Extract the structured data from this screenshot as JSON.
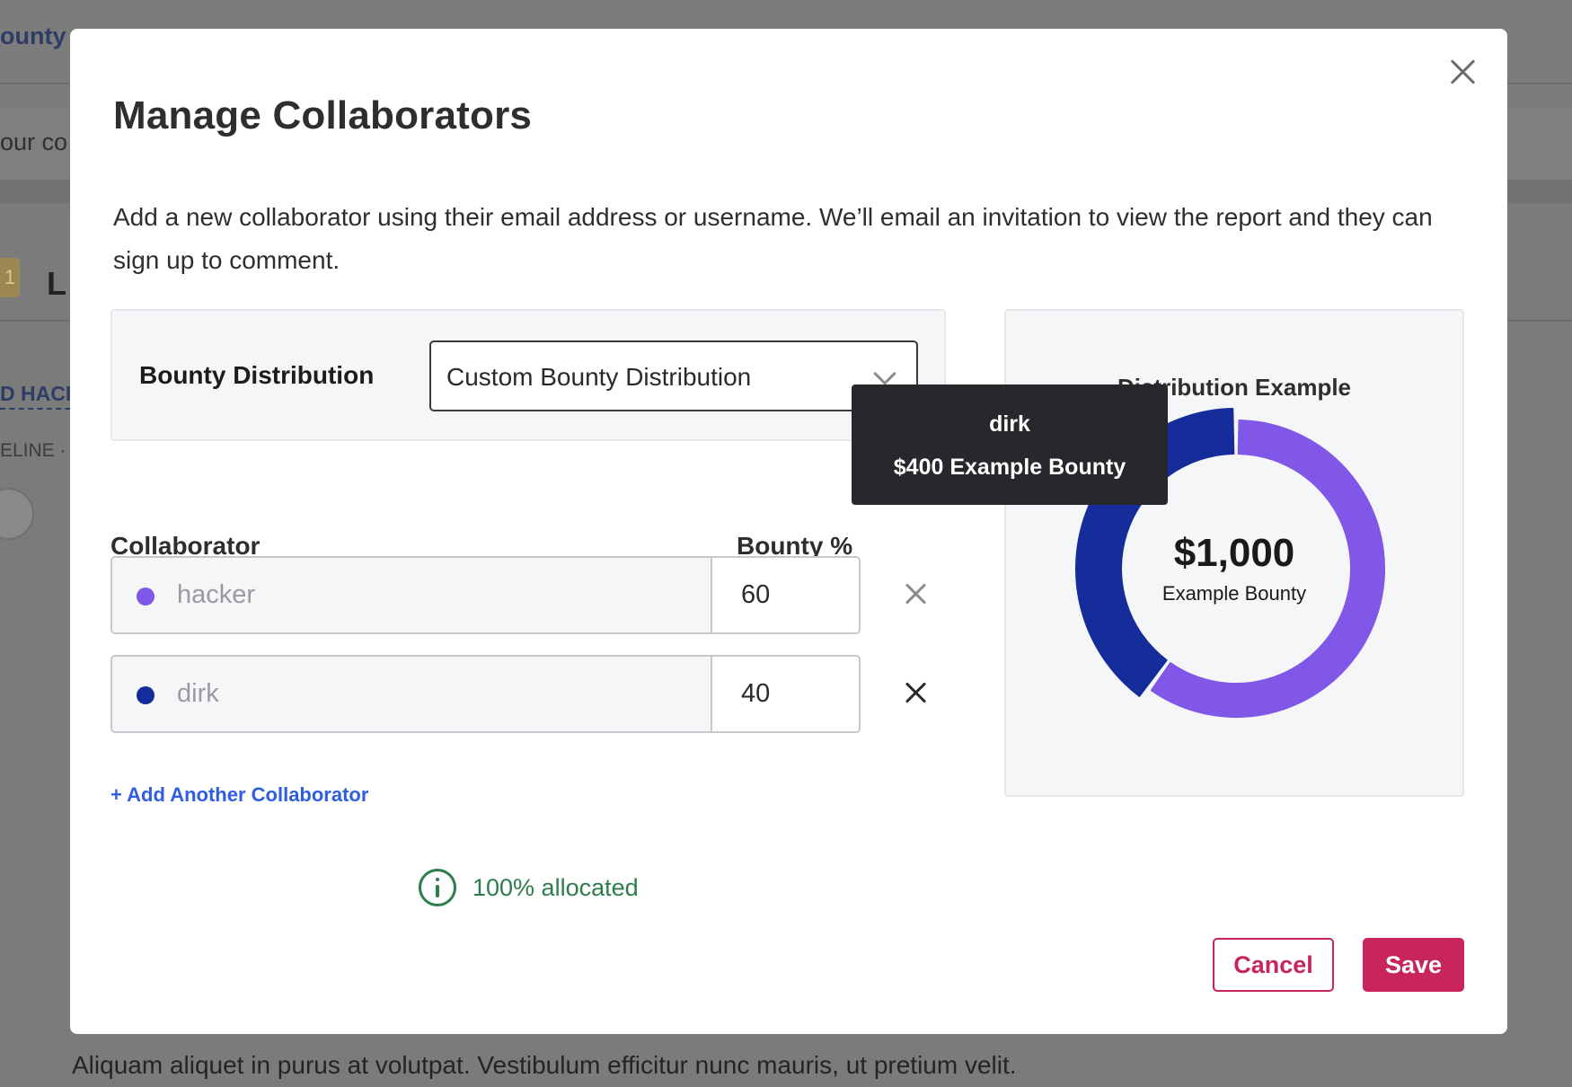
{
  "background": {
    "crumb": "ounty",
    "compose": "our co",
    "badge": "1",
    "title": "L",
    "hack_link": "HACK",
    "hack_prefix": "D",
    "eline": "ELINE ·",
    "lorem": "Aliquam aliquet in purus at volutpat. Vestibulum efficitur nunc mauris, ut pretium velit."
  },
  "modal": {
    "title": "Manage Collaborators",
    "description": "Add a new collaborator using their email address or username. We’ll email an invitation to view the report and they can sign up to comment.",
    "distribution": {
      "label": "Bounty Distribution",
      "selected": "Custom Bounty Distribution"
    },
    "columns": {
      "collaborator": "Collaborator",
      "bounty_pct": "Bounty %"
    },
    "collaborators": [
      {
        "name": "hacker",
        "percent": "60",
        "color": "#8057e6"
      },
      {
        "name": "dirk",
        "percent": "40",
        "color": "#152c9b"
      }
    ],
    "add_link": "+ Add Another Collaborator",
    "allocated": "100% allocated",
    "cancel_label": "Cancel",
    "save_label": "Save"
  },
  "example": {
    "title": "Distribution Example",
    "center_value": "$1,000",
    "center_label": "Example Bounty",
    "tooltip": {
      "name": "dirk",
      "amount": "$400 Example Bounty"
    }
  },
  "chart_data": {
    "type": "pie",
    "categories": [
      "hacker",
      "dirk"
    ],
    "values": [
      60,
      40
    ],
    "colors": [
      "#8057e6",
      "#152c9b"
    ],
    "highlighted": "dirk"
  },
  "colors": {
    "accent": "#c8245e",
    "link": "#2f5fe0",
    "success": "#2d7d4d"
  }
}
